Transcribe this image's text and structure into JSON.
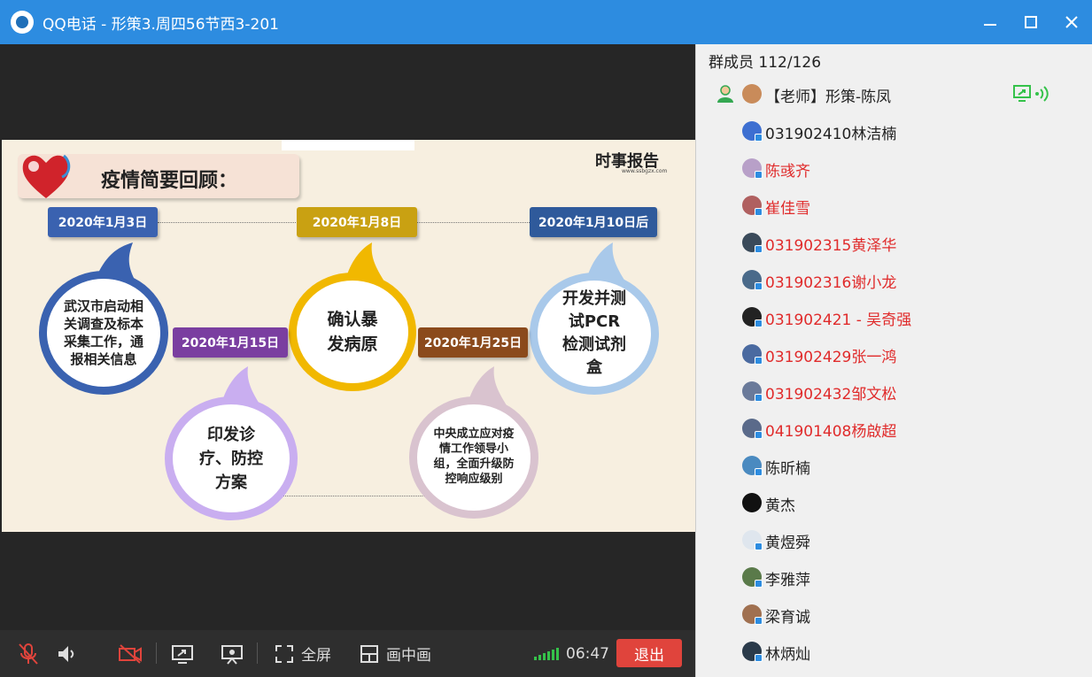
{
  "window": {
    "title": "QQ电话 - 形策3.周四56节西3-201",
    "controls": [
      "minimize",
      "maximize",
      "close"
    ]
  },
  "slide": {
    "title": "疫情简要回顾：",
    "brand": "时事报告",
    "brand_sub": "www.ssbgzx.com",
    "events": [
      {
        "date": "2020年1月3日",
        "text": "武汉市启动相关调查及标本采集工作，通报相关信息",
        "color": "#3a62b0"
      },
      {
        "date": "2020年1月8日",
        "text": "确认暴发病原",
        "color": "#c9a112"
      },
      {
        "date": "2020年1月10日后",
        "text": "开发并测试PCR检测试剂盒",
        "color": "#2f5a9b"
      },
      {
        "date": "2020年1月15日",
        "text": "印发诊疗、防控方案",
        "color": "#7a3ea0"
      },
      {
        "date": "2020年1月25日",
        "text": "中央成立应对疫情工作领导小组，全面升级防控响应级别",
        "color": "#8b4a1c"
      }
    ]
  },
  "toolbar": {
    "mic_icon": "mic-muted-icon",
    "speaker_icon": "speaker-icon",
    "camera_icon": "camera-off-icon",
    "share_icon": "screen-share-icon",
    "whiteboard_icon": "presentation-icon",
    "fullscreen_label": "全屏",
    "pip_label": "画中画",
    "duration": "06:47",
    "exit_label": "退出",
    "signal_color": "#35c24a",
    "exit_color": "#e0443c"
  },
  "members": {
    "header": "群成员 112/126",
    "list": [
      {
        "name": "【老师】形策-陈凤",
        "red": false
      },
      {
        "name": "031902410林洁楠",
        "red": false
      },
      {
        "name": "陈彧齐",
        "red": true
      },
      {
        "name": "崔佳雪",
        "red": true
      },
      {
        "name": "031902315黄泽华",
        "red": true
      },
      {
        "name": "031902316谢小龙",
        "red": true
      },
      {
        "name": "031902421 - 吴奇强",
        "red": true
      },
      {
        "name": "031902429张一鸿",
        "red": true
      },
      {
        "name": "031902432邹文松",
        "red": true
      },
      {
        "name": "041901408杨啟超",
        "red": true
      },
      {
        "name": "陈昕楠",
        "red": false
      },
      {
        "name": "黄杰",
        "red": false
      },
      {
        "name": "黄煜舜",
        "red": false
      },
      {
        "name": "李雅萍",
        "red": false
      },
      {
        "name": "梁育诚",
        "red": false
      },
      {
        "name": "林炳灿",
        "red": false
      }
    ]
  }
}
